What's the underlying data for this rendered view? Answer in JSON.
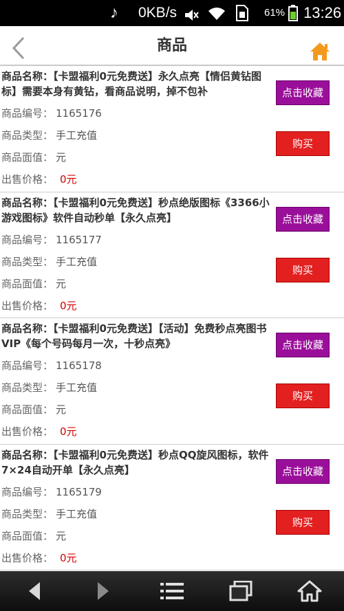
{
  "status_bar": {
    "net_speed": "0KB/s",
    "battery_pct": "61%",
    "time": "13:26",
    "icons": [
      "music-muted-icon",
      "volume-muted-icon",
      "wifi-icon",
      "sim-icon",
      "battery-icon"
    ]
  },
  "header": {
    "title": "商品",
    "back_icon": "chevron-left-icon",
    "home_icon": "home-icon",
    "home_color": "#f39a1e"
  },
  "labels": {
    "code": "商品编号：",
    "type": "商品类型：",
    "face_value": "商品面值：",
    "price": "出售价格：",
    "fav_button": "点击收藏",
    "buy_button": "购买"
  },
  "items": [
    {
      "name": "商品名称：【卡盟福利0元免费送】永久点亮【情侣黄钻图标】需要本身有黄钻，看商品说明，掉不包补",
      "code": "1165176",
      "type": "手工充值",
      "face_value": "元",
      "price": "0元"
    },
    {
      "name": "商品名称：【卡盟福利0元免费送】秒点绝版图标《3366小游戏图标》软件自动秒单【永久点亮】",
      "code": "1165177",
      "type": "手工充值",
      "face_value": "元",
      "price": "0元"
    },
    {
      "name": "商品名称：【卡盟福利0元免费送】【活动】免费秒点亮图书VIP《每个号码每月一次，十秒点亮》",
      "code": "1165178",
      "type": "手工充值",
      "face_value": "元",
      "price": "0元"
    },
    {
      "name": "商品名称：【卡盟福利0元免费送】秒点QQ旋风图标，软件7×24自动开单【永久点亮】",
      "code": "1165179",
      "type": "手工充值",
      "face_value": "元",
      "price": "0元"
    }
  ],
  "colors": {
    "fav_button": "#9a0f9a",
    "buy_button": "#e32020",
    "price": "#d40000"
  },
  "nav": [
    "back-icon",
    "forward-icon",
    "menu-icon",
    "recent-apps-icon",
    "home-icon"
  ]
}
